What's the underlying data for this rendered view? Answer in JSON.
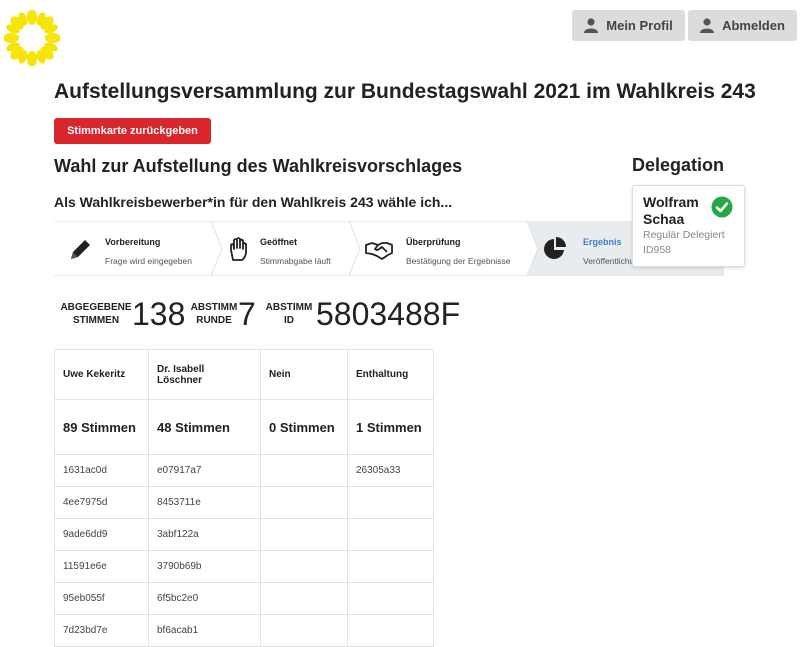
{
  "header": {
    "profile_label": "Mein Profil",
    "logout_label": "Abmelden"
  },
  "page": {
    "title": "Aufstellungsversammlung zur Bundestagswahl 2021 im Wahlkreis 243",
    "return_ballot_label": "Stimmkarte zurückgeben",
    "election_title": "Wahl zur Aufstellung des Wahlkreisvorschlages",
    "question": "Als Wahlkreisbewerber*in für den Wahlkreis 243 wähle ich..."
  },
  "steps": [
    {
      "title": "Vorbereitung",
      "subtitle": "Frage wird eingegeben",
      "icon": "pencil-icon"
    },
    {
      "title": "Geöffnet",
      "subtitle": "Stimmabgabe läuft",
      "icon": "hand-icon"
    },
    {
      "title": "Überprüfung",
      "subtitle": "Bestätigung der Ergebnisse",
      "icon": "handshake-icon"
    },
    {
      "title": "Ergebnis",
      "subtitle": "Veröffentlichung",
      "icon": "pie-chart-icon"
    }
  ],
  "delegation": {
    "title": "Delegation",
    "name_line1": "Wolfram",
    "name_line2": "Schaa",
    "role": "Regulär Delegiert",
    "id": "ID958",
    "status_color": "#28a745"
  },
  "stats": {
    "votes_label_1": "ABGEGEBENE",
    "votes_label_2": "STIMMEN",
    "votes_value": "138",
    "round_label_1": "ABSTIMM",
    "round_label_2": "RUNDE",
    "round_value": "7",
    "id_label_1": "ABSTIMM",
    "id_label_2": "ID",
    "id_value": "5803488F"
  },
  "results": {
    "columns": [
      "Uwe Kekeritz",
      "Dr. Isabell Löschner",
      "Nein",
      "Enthaltung"
    ],
    "totals": [
      "89 Stimmen",
      "48 Stimmen",
      "0 Stimmen",
      "1 Stimmen"
    ],
    "rows": [
      [
        "1631ac0d",
        "e07917a7",
        "",
        "26305a33"
      ],
      [
        "4ee7975d",
        "8453711e",
        "",
        ""
      ],
      [
        "9ade6dd9",
        "3abf122a",
        "",
        ""
      ],
      [
        "11591e6e",
        "3790b69b",
        "",
        ""
      ],
      [
        "95eb055f",
        "6f5bc2e0",
        "",
        ""
      ],
      [
        "7d23bd7e",
        "bf6acab1",
        "",
        ""
      ]
    ]
  },
  "colors": {
    "brand_yellow": "#f5e50a",
    "danger": "#d9262c",
    "active_step": "#3b7fc4"
  }
}
